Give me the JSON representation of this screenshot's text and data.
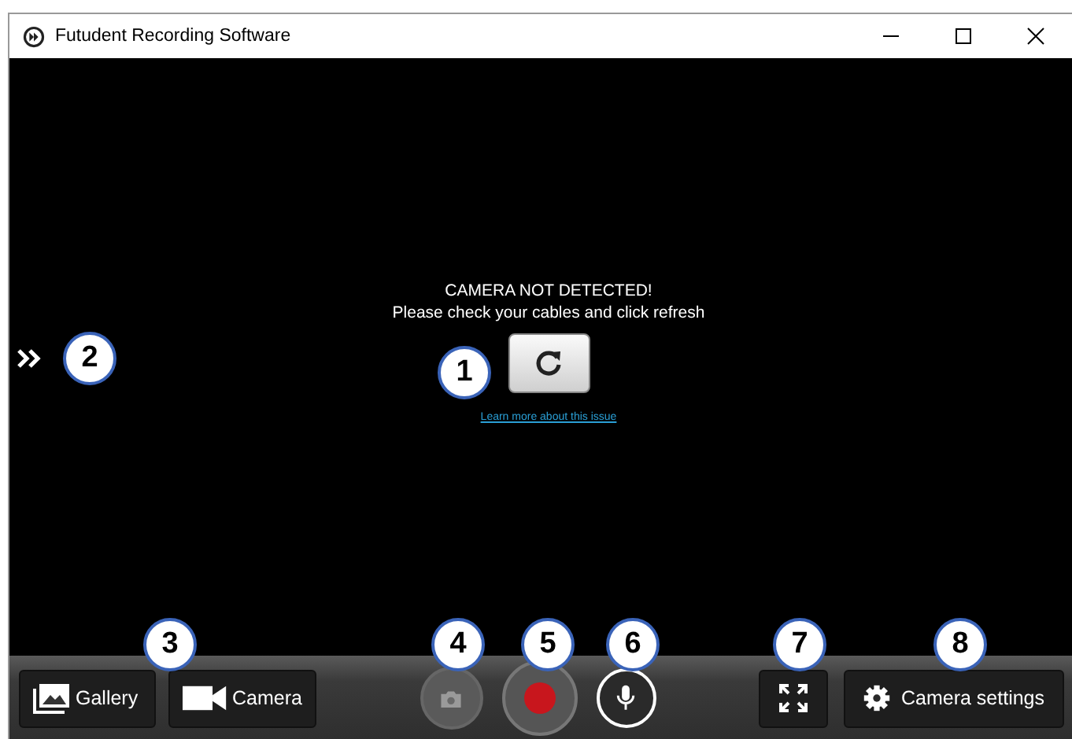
{
  "window": {
    "title": "Futudent Recording Software"
  },
  "message": {
    "heading": "CAMERA NOT DETECTED!",
    "text": "Please check your cables and click refresh",
    "link": "Learn more about this issue"
  },
  "toolbar": [
    {
      "kind": "gallery",
      "label": "Gallery",
      "disabled": false
    },
    {
      "kind": "camera",
      "label": "Camera",
      "disabled": false
    },
    {
      "kind": "snapshot",
      "disabled": true
    },
    {
      "kind": "record",
      "disabled": false
    },
    {
      "kind": "microphone",
      "disabled": false
    },
    {
      "kind": "fullscreen",
      "disabled": false
    },
    {
      "kind": "settings",
      "label": "Camera settings",
      "disabled": false
    }
  ],
  "callouts": [
    {
      "label": "2"
    },
    {
      "label": "1"
    },
    {
      "label": "3"
    },
    {
      "label": "4"
    },
    {
      "label": "5"
    },
    {
      "label": "6"
    },
    {
      "label": "7"
    },
    {
      "label": "8"
    }
  ]
}
